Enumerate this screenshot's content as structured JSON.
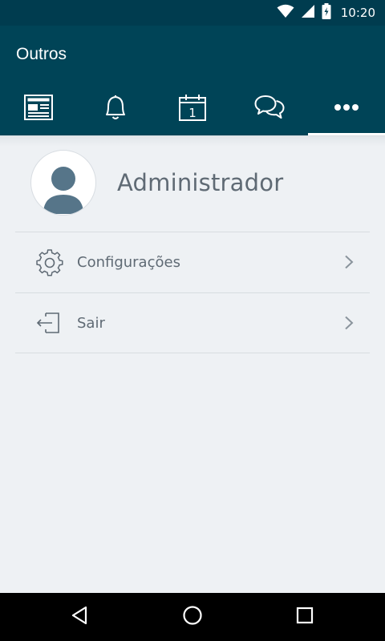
{
  "status_bar": {
    "time": "10:20",
    "icons": [
      "wifi-icon",
      "cellular-signal-icon",
      "battery-charging-icon"
    ]
  },
  "app_bar": {
    "title": "Outros",
    "tabs": [
      {
        "icon": "newspaper-icon",
        "active": false
      },
      {
        "icon": "bell-icon",
        "active": false
      },
      {
        "icon": "calendar-icon",
        "active": false,
        "badge_text": "1"
      },
      {
        "icon": "chat-bubbles-icon",
        "active": false
      },
      {
        "icon": "more-horizontal-icon",
        "active": true
      }
    ],
    "background_color": "#004457",
    "indicator_color": "#ffffff"
  },
  "profile": {
    "name": "Administrador",
    "avatar_icon": "user-avatar-icon"
  },
  "menu": {
    "items": [
      {
        "label": "Configurações",
        "icon": "gear-icon"
      },
      {
        "label": "Sair",
        "icon": "logout-icon"
      }
    ]
  },
  "nav_bar": {
    "buttons": [
      "back-triangle-icon",
      "home-circle-icon",
      "recents-square-icon"
    ]
  }
}
